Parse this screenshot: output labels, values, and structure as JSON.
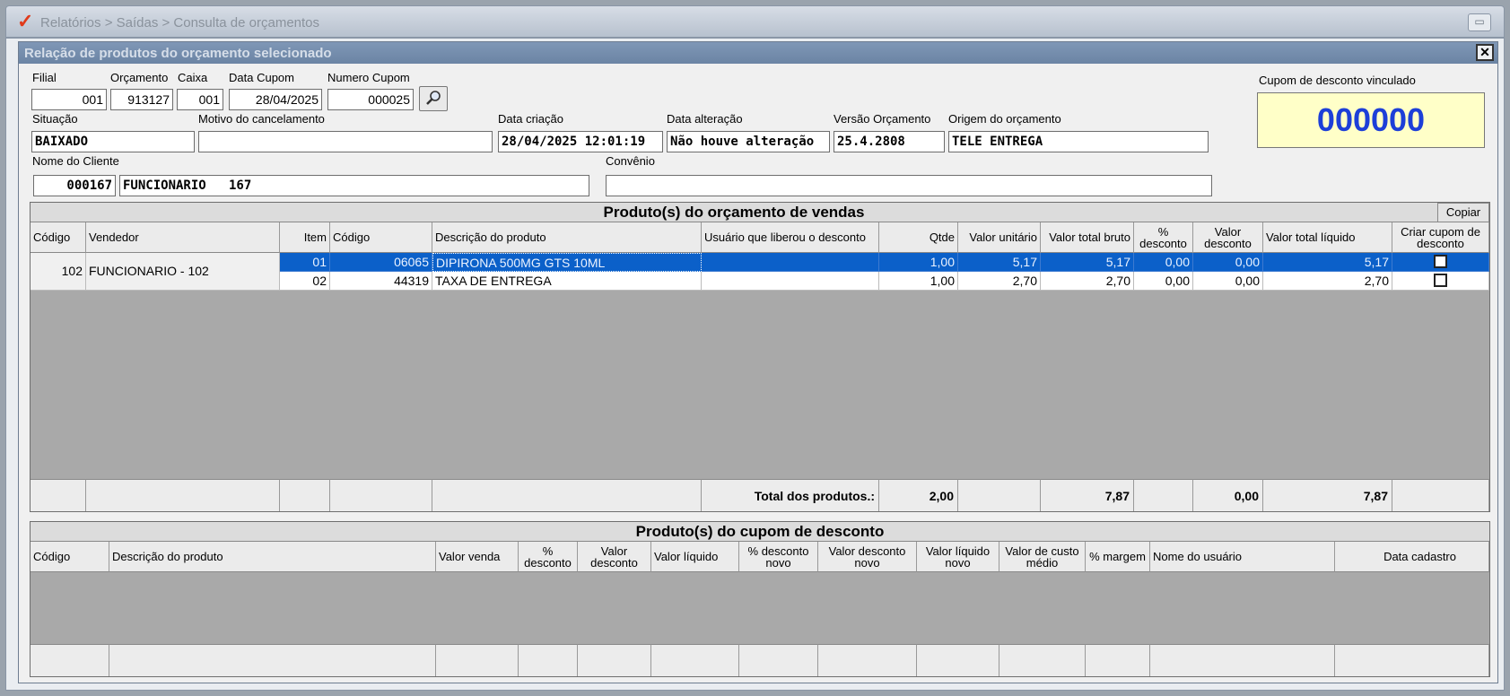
{
  "window": {
    "breadcrumb": "Relatórios > Saídas > Consulta de orçamentos",
    "restore_glyph": "▭"
  },
  "dialog": {
    "title": "Relação de produtos do orçamento selecionado",
    "close_glyph": "✕"
  },
  "form": {
    "filial": {
      "label": "Filial",
      "value": "001"
    },
    "orcamento": {
      "label": "Orçamento",
      "value": "913127"
    },
    "caixa": {
      "label": "Caixa",
      "value": "001"
    },
    "data_cupom": {
      "label": "Data Cupom",
      "value": "28/04/2025"
    },
    "numero_cupom": {
      "label": "Numero Cupom",
      "value": "000025"
    },
    "situacao": {
      "label": "Situação",
      "value": "BAIXADO"
    },
    "motivo": {
      "label": "Motivo do cancelamento",
      "value": ""
    },
    "data_criacao": {
      "label": "Data criação",
      "value": "28/04/2025 12:01:19"
    },
    "data_alteracao": {
      "label": "Data alteração",
      "value": "Não houve alteração"
    },
    "versao": {
      "label": "Versão Orçamento",
      "value": "25.4.2808"
    },
    "origem": {
      "label": "Origem do orçamento",
      "value": "TELE ENTREGA"
    },
    "cliente": {
      "label": "Nome do Cliente",
      "code": "000167",
      "name": "FUNCIONARIO   167"
    },
    "convenio": {
      "label": "Convênio",
      "value": ""
    },
    "cupom_desconto": {
      "label": "Cupom de desconto vinculado",
      "value": "000000"
    }
  },
  "products_grid": {
    "title": "Produto(s) do orçamento de vendas",
    "copy_label": "Copiar",
    "headers": {
      "codigo": "Código",
      "vendedor": "Vendedor",
      "item": "Item",
      "codigo2": "Código",
      "descricao": "Descrição do produto",
      "usuario": "Usuário que liberou o  desconto",
      "qtde": "Qtde",
      "valor_unitario": "Valor unitário",
      "valor_total_bruto": "Valor total bruto",
      "pct_desconto": "% desconto",
      "valor_desconto": "Valor desconto",
      "valor_total_liquido": "Valor total líquido",
      "criar_cupom": "Criar cupom de desconto"
    },
    "group": {
      "codigo": "102",
      "vendedor": "FUNCIONARIO - 102"
    },
    "rows": [
      {
        "item": "01",
        "codigo": "06065",
        "descricao": "DIPIRONA 500MG GTS 10ML",
        "usuario": "",
        "qtde": "1,00",
        "valor_unitario": "5,17",
        "valor_total_bruto": "5,17",
        "pct_desconto": "0,00",
        "valor_desconto": "0,00",
        "valor_total_liquido": "5,17"
      },
      {
        "item": "02",
        "codigo": "44319",
        "descricao": "TAXA DE ENTREGA",
        "usuario": "",
        "qtde": "1,00",
        "valor_unitario": "2,70",
        "valor_total_bruto": "2,70",
        "pct_desconto": "0,00",
        "valor_desconto": "0,00",
        "valor_total_liquido": "2,70"
      }
    ],
    "footer": {
      "label": "Total dos produtos.:",
      "qtde": "2,00",
      "valor_total_bruto": "7,87",
      "valor_desconto": "0,00",
      "valor_total_liquido": "7,87"
    }
  },
  "coupon_grid": {
    "title": "Produto(s) do cupom de desconto",
    "headers": {
      "codigo": "Código",
      "descricao": "Descrição do produto",
      "valor_venda": "Valor venda",
      "pct_desconto": "% desconto",
      "valor_desconto": "Valor desconto",
      "valor_liquido": "Valor líquido",
      "pct_desconto_novo": "% desconto novo",
      "valor_desconto_novo": "Valor desconto novo",
      "valor_liquido_novo": "Valor líquido novo",
      "valor_custo_medio": "Valor de custo médio",
      "pct_margem": "% margem",
      "nome_usuario": "Nome do usuário",
      "data_cadastro": "Data cadastro"
    }
  }
}
